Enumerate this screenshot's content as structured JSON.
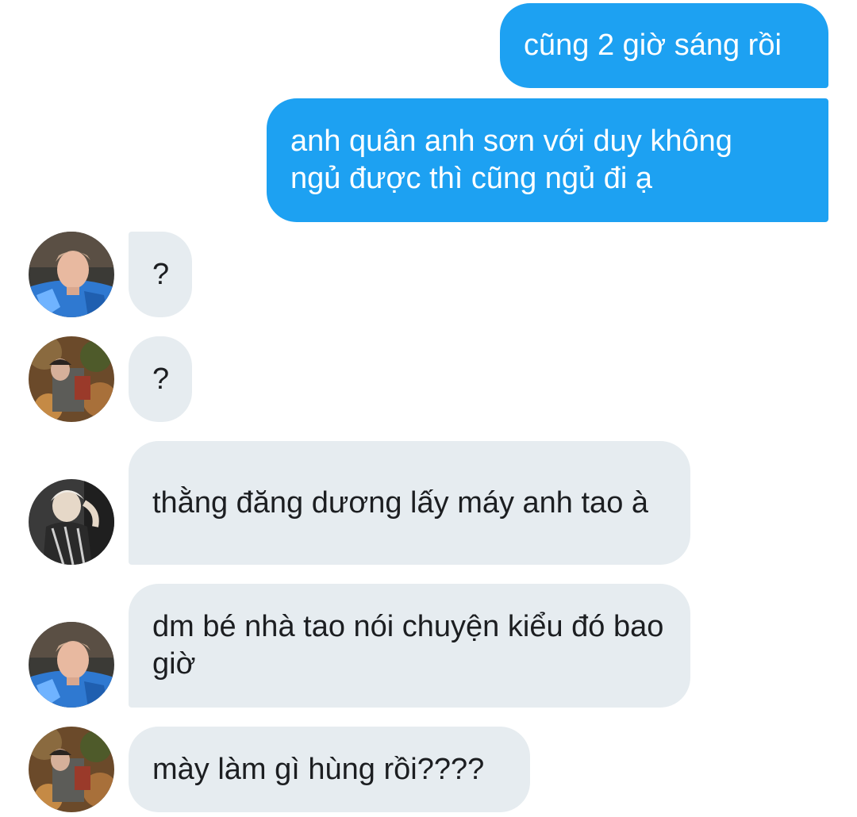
{
  "conversation": {
    "outgoing": [
      {
        "text": "cũng 2 giờ sáng rồi"
      },
      {
        "text": "anh quân anh sơn với duy không ngủ được thì cũng ngủ đi ạ"
      }
    ],
    "incoming": [
      {
        "sender_avatar": "avatar-blue-shirt",
        "text": "?"
      },
      {
        "sender_avatar": "avatar-outdoor-garden",
        "text": "?"
      },
      {
        "sender_avatar": "avatar-white-hair",
        "text": "thằng đăng dương lấy máy anh tao à"
      },
      {
        "sender_avatar": "avatar-blue-shirt",
        "text": "dm bé nhà tao nói chuyện kiểu đó bao giờ"
      },
      {
        "sender_avatar": "avatar-outdoor-garden",
        "text": "mày làm gì hùng rồi????"
      }
    ]
  },
  "colors": {
    "outgoing_bubble": "#1da1f2",
    "incoming_bubble": "#e6ecf0",
    "outgoing_text": "#ffffff",
    "incoming_text": "#1c1e21"
  }
}
